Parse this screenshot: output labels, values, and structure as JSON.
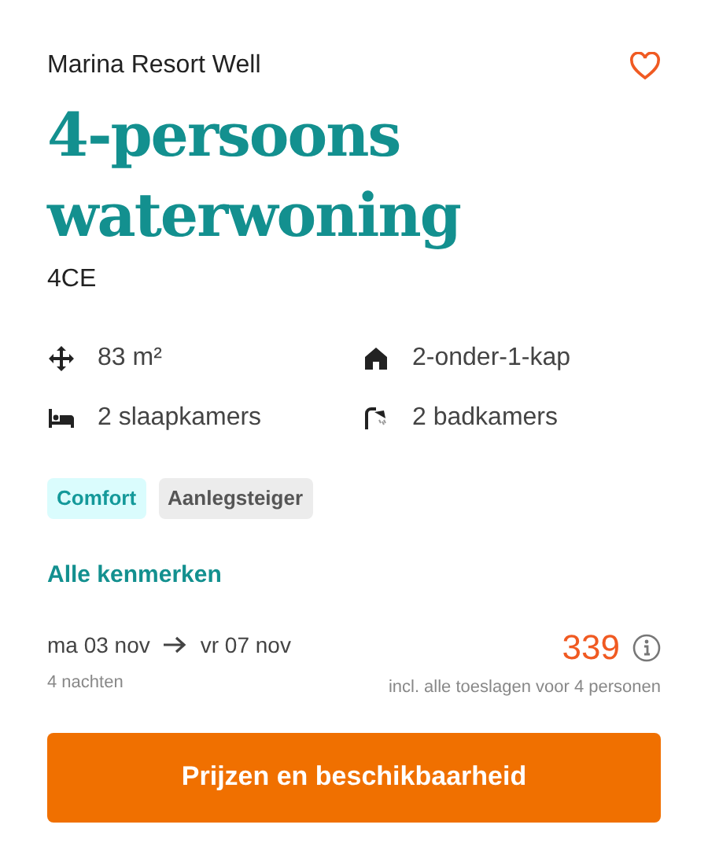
{
  "park": "Marina Resort Well",
  "title": "4-persoons waterwoning",
  "code": "4CE",
  "features": [
    {
      "kind": "area",
      "text": "83 m²"
    },
    {
      "kind": "house",
      "text": "2-onder-1-kap"
    },
    {
      "kind": "bed",
      "text": "2 slaapkamers"
    },
    {
      "kind": "shower",
      "text": "2 badkamers"
    }
  ],
  "tags": [
    {
      "label": "Comfort",
      "color": "#dafcfd"
    },
    {
      "label": "Aanlegsteiger",
      "color": "#ececec"
    }
  ],
  "all_features_link": "Alle kenmerken",
  "arrival": "ma 03 nov",
  "departure": "vr 07 nov",
  "nights": "4 nachten",
  "price": "339",
  "price_note": "incl. alle toeslagen voor 4 personen",
  "button": "Prijzen en beschikbaarheid"
}
